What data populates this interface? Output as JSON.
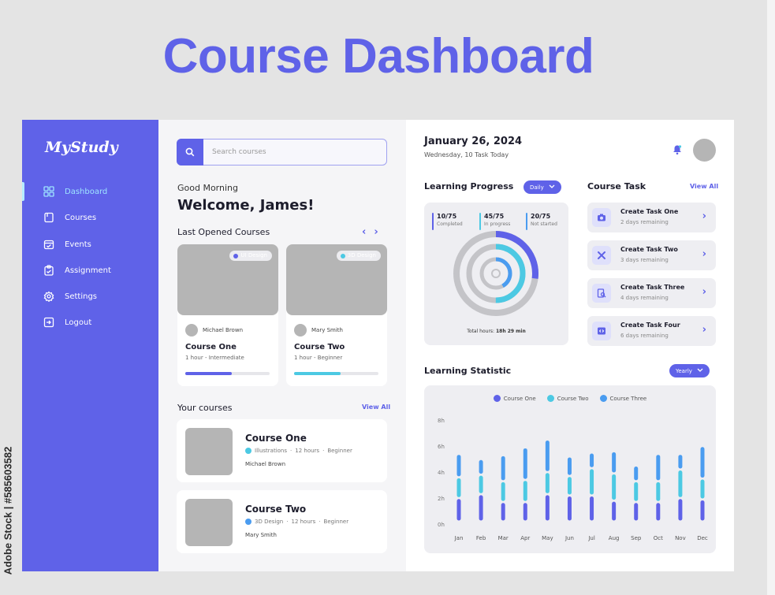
{
  "header": {
    "title": "Course Dashboard"
  },
  "watermark": "Adobe Stock | #585603582",
  "colors": {
    "accent": "#5f62e8",
    "cyan": "#4cc9e3",
    "blue": "#4a9cf0",
    "gray": "#b5b5b5"
  },
  "sidebar": {
    "logo": "MyStudy",
    "items": [
      {
        "label": "Dashboard",
        "icon": "grid-icon",
        "active": true
      },
      {
        "label": "Courses",
        "icon": "book-icon"
      },
      {
        "label": "Events",
        "icon": "calendar-icon"
      },
      {
        "label": "Assignment",
        "icon": "clipboard-icon"
      },
      {
        "label": "Settings",
        "icon": "gear-icon"
      },
      {
        "label": "Logout",
        "icon": "logout-icon"
      }
    ]
  },
  "search": {
    "placeholder": "Search courses"
  },
  "greeting": "Good Morning",
  "welcome": "Welcome, James!",
  "last_opened": {
    "title": "Last Opened Courses",
    "courses": [
      {
        "tag": "UI Design",
        "author": "Michael Brown",
        "name": "Course One",
        "meta": "1 hour - Intermediate",
        "progress": 0.55,
        "color": "#5f62e8"
      },
      {
        "tag": "3D Design",
        "author": "Mary Smith",
        "name": "Course Two",
        "meta": "1 hour - Beginner",
        "progress": 0.55,
        "color": "#4cc9e3"
      }
    ]
  },
  "your_courses": {
    "title": "Your courses",
    "view_all": "View All",
    "items": [
      {
        "name": "Course One",
        "category": "Illustrations",
        "hours": "12 hours",
        "level": "Beginner",
        "author": "Michael Brown",
        "dot": "#4cc9e3"
      },
      {
        "name": "Course Two",
        "category": "3D Design",
        "hours": "12 hours",
        "level": "Beginner",
        "author": "Mary Smith",
        "dot": "#4a9cf0"
      }
    ]
  },
  "date": {
    "main": "January 26, 2024",
    "sub": "Wednesday, 10 Task Today"
  },
  "learning_progress": {
    "title": "Learning Progress",
    "dropdown": "Daily",
    "stats": [
      {
        "value": "10/75",
        "label": "Completed",
        "color": "#5f62e8"
      },
      {
        "value": "45/75",
        "label": "In progress",
        "color": "#4cc9e3"
      },
      {
        "value": "20/75",
        "label": "Not started",
        "color": "#4a9cf0"
      }
    ],
    "total_label": "Total hours:",
    "total_value": "18h 29 min",
    "rings": [
      {
        "fraction": 0.27,
        "color": "#5f62e8"
      },
      {
        "fraction": 0.5,
        "color": "#4cc9e3"
      },
      {
        "fraction": 0.42,
        "color": "#4a9cf0"
      }
    ]
  },
  "course_task": {
    "title": "Course Task",
    "view_all": "View All",
    "items": [
      {
        "title": "Create Task One",
        "sub": "2 days remaining",
        "icon": "camera-icon"
      },
      {
        "title": "Create Task Two",
        "sub": "3 days remaining",
        "icon": "tools-icon"
      },
      {
        "title": "Create Task Three",
        "sub": "4 days remaining",
        "icon": "search-doc-icon"
      },
      {
        "title": "Create Task Four",
        "sub": "6 days remaining",
        "icon": "code-icon"
      }
    ]
  },
  "learning_statistic": {
    "title": "Learning Statistic",
    "dropdown": "Yearly"
  },
  "chart_data": {
    "type": "bar",
    "categories": [
      "Jan",
      "Feb",
      "Mar",
      "Apr",
      "May",
      "Jun",
      "Jul",
      "Aug",
      "Sep",
      "Oct",
      "Nov",
      "Dec"
    ],
    "series": [
      {
        "name": "Course One",
        "color": "#5f62e8",
        "values": [
          1.8,
          2.1,
          1.5,
          1.5,
          2.1,
          2.0,
          2.0,
          1.6,
          1.5,
          1.5,
          1.8,
          1.7
        ]
      },
      {
        "name": "Course Two",
        "color": "#4cc9e3",
        "values": [
          1.6,
          1.5,
          1.6,
          1.7,
          1.7,
          1.5,
          2.1,
          2.1,
          1.6,
          1.6,
          2.2,
          1.6
        ]
      },
      {
        "name": "Course Three",
        "color": "#4a9cf0",
        "values": [
          1.8,
          1.2,
          2.0,
          2.5,
          2.5,
          1.5,
          1.2,
          1.7,
          1.2,
          2.1,
          1.2,
          2.5
        ]
      }
    ],
    "yticks": [
      "0h",
      "2h",
      "4h",
      "6h",
      "8h"
    ],
    "ylim": [
      0,
      8
    ],
    "grid": false,
    "legend": "top-center"
  }
}
